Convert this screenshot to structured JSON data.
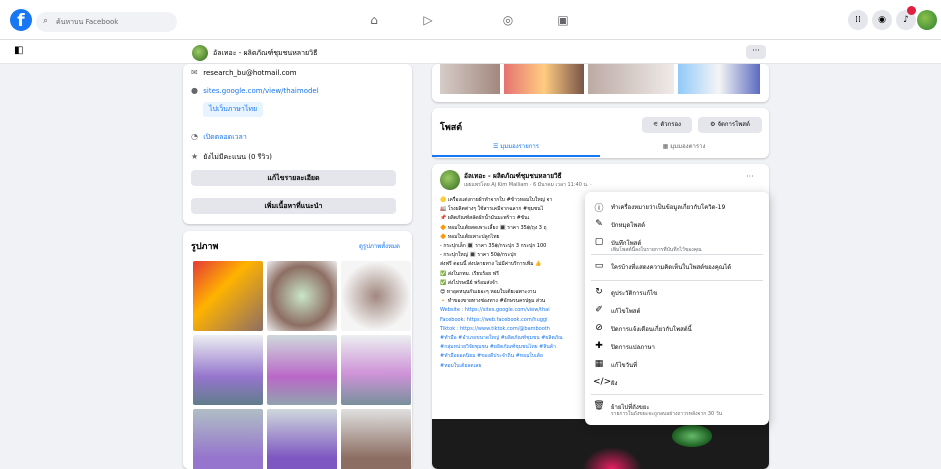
{
  "topbar": {
    "search_placeholder": "ค้นหาบน Facebook"
  },
  "page": {
    "name": "อัลเทอะ - ผลิตภัณฑ์ชุมชนหลายวิธี"
  },
  "intro": {
    "email": "research_bu@hotmail.com",
    "website": "sites.google.com/view/thaimodel",
    "translate_link": "ไปเว็บภาษาไทย",
    "open_now": "เปิดตลอดเวลา",
    "rating": "ยังไม่มีคะแนน (0 รีวิว)",
    "edit_details": "แก้ไขรายละเอียด",
    "add_featured": "เพิ่มเนื้อหาที่แนะนำ"
  },
  "photos": {
    "title": "รูปภาพ",
    "see_all": "ดูรูปภาพทั้งหมด"
  },
  "posts": {
    "title": "โพสต์",
    "filter": "ตัวกรอง",
    "manage": "จัดการโพสต์",
    "tab_list": "มุมมองรายการ",
    "tab_grid": "มุมมองตาราง"
  },
  "post": {
    "author": "อัลเทอะ - ผลิตภัณฑ์ชุมชนหลายวิธี",
    "meta": "เผยแพร่โดย Aj Kim Malliam · 6 มีนาคม เวลา 11:40 น. ·",
    "lines": [
      "🟡 เครื่องแต่งกายผ้าทำจากใบ #ข้าวหอมใบใหญ่ จา",
      "🏭 โรงผลิตต่างๆ ใช้สารเคมีจากฉลาก #ชุมชนไ",
      "📌 ผลิตภัณฑ์สลัดผักน้ำมันมะพร้าว #ขันเ",
      "🔶 หอมใบเต้ยสดเพาะเลี้ยง 🔳 ราคา 35฿/ถุง 3 ถุ",
      "🔶 หอมใบเต้ยเพาะปลูกไทย",
      "- กระปุกเล็ก 🔳 ราคา 35฿/กระปุก 3 กระปุก 100",
      "- กระปุกใหญ่ 🔳 ราคา 50฿/กระปุก",
      "ส่งฟรี ตอนนี้ ส่งปลายทาง ไม่มีค่าบริการเพิ่ม 👍",
      "✅ ส่งในกทม. เรียบร้อย ฟรี",
      "✅ ส่งไปรษณีย์ พร้อมส่งจ้า",
      "😍 หาอุดหนุนกันเยอะๆ หอมใบเต้ยเฉพาะงาน",
      "🔸 ทำของขายทางช่องทาง #อักษรนครปฐม ส่วน",
      "Website : https://sites.google.com/view/thai",
      "Facebook: https://web.facebook.com/huggi",
      "Tiktok : https://www.tiktok.com/@bambooth",
      "#ทำมือ #อำเภอขนาดใหญ่ #ผลิตภัณฑ์ชุมชน #ผลิตภัณ",
      "#กลุ่มหน่วยวิจัยชุมชน #ผลิตภัณฑ์ชุมชนไทย #สินค้า",
      "#ทำมือยอดนิยม #ของดีประจำถิ่น #หอมใบเต้ย",
      "#หอมใบเต้ยลดเลย"
    ]
  },
  "menu": {
    "items": [
      {
        "icon": "info-icon",
        "glyph": "ⓘ",
        "label": "ทำเครื่องหมายว่าเป็นข้อมูลเกี่ยวกับโควิด-19",
        "sub": ""
      },
      {
        "icon": "pin-icon",
        "glyph": "✎",
        "label": "ปักหมุดโพสต์",
        "sub": ""
      },
      {
        "icon": "bookmark-icon",
        "glyph": "▢",
        "label": "บันทึกโพสต์",
        "sub": "เพิ่มโพสต์นี้ลงในรายการที่บันทึกไว้ของคุณ"
      },
      {
        "icon": "comment-icon",
        "glyph": "▭",
        "label": "ใครบ้างที่แสดงความคิดเห็นในโพสต์ของคุณได้",
        "sub": ""
      },
      {
        "icon": "history-icon",
        "glyph": "↻",
        "label": "ดูประวัติการแก้ไข",
        "sub": ""
      },
      {
        "icon": "edit-icon",
        "glyph": "✐",
        "label": "แก้ไขโพสต์",
        "sub": ""
      },
      {
        "icon": "bell-off-icon",
        "glyph": "⊘",
        "label": "ปิดการแจ้งเตือนเกี่ยวกับโพสต์นี้",
        "sub": ""
      },
      {
        "icon": "translate-icon",
        "glyph": "✚",
        "label": "ปิดการแปลภาษา",
        "sub": ""
      },
      {
        "icon": "date-icon",
        "glyph": "▦",
        "label": "แก้ไขวันที่",
        "sub": ""
      },
      {
        "icon": "embed-icon",
        "glyph": "</>",
        "label": "ฝัง",
        "sub": ""
      },
      {
        "icon": "trash-icon",
        "glyph": "🗑",
        "label": "ย้ายไปที่ถังขยะ",
        "sub": "รายการในถังขยะจะถูกลบอย่างถาวรหลังจาก 30 วัน"
      }
    ]
  },
  "colors": {
    "accent": "#1877f2",
    "background": "#f0f2f5",
    "card": "#ffffff"
  }
}
